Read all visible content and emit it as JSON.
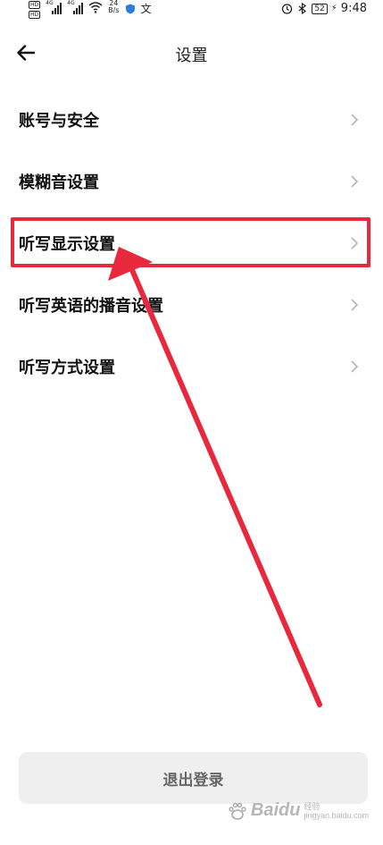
{
  "status_bar": {
    "hd1": "HD",
    "hd2": "HD",
    "net1": "4G",
    "net2": "4G",
    "speed_value": "24",
    "speed_unit": "B/s",
    "translate_glyph": "文",
    "battery": "52",
    "time": "9:48"
  },
  "header": {
    "title": "设置"
  },
  "settings": {
    "items": [
      {
        "label": "账号与安全"
      },
      {
        "label": "模糊音设置"
      },
      {
        "label": "听写显示设置"
      },
      {
        "label": "听写英语的播音设置"
      },
      {
        "label": "听写方式设置"
      }
    ]
  },
  "logout": {
    "label": "退出登录"
  },
  "watermark": {
    "main": "Baidu",
    "sub_top": "经验",
    "sub_bottom": "jingyan.baidu.com"
  },
  "colors": {
    "annotation_red": "#e8283c",
    "logout_bg": "#efefef"
  }
}
